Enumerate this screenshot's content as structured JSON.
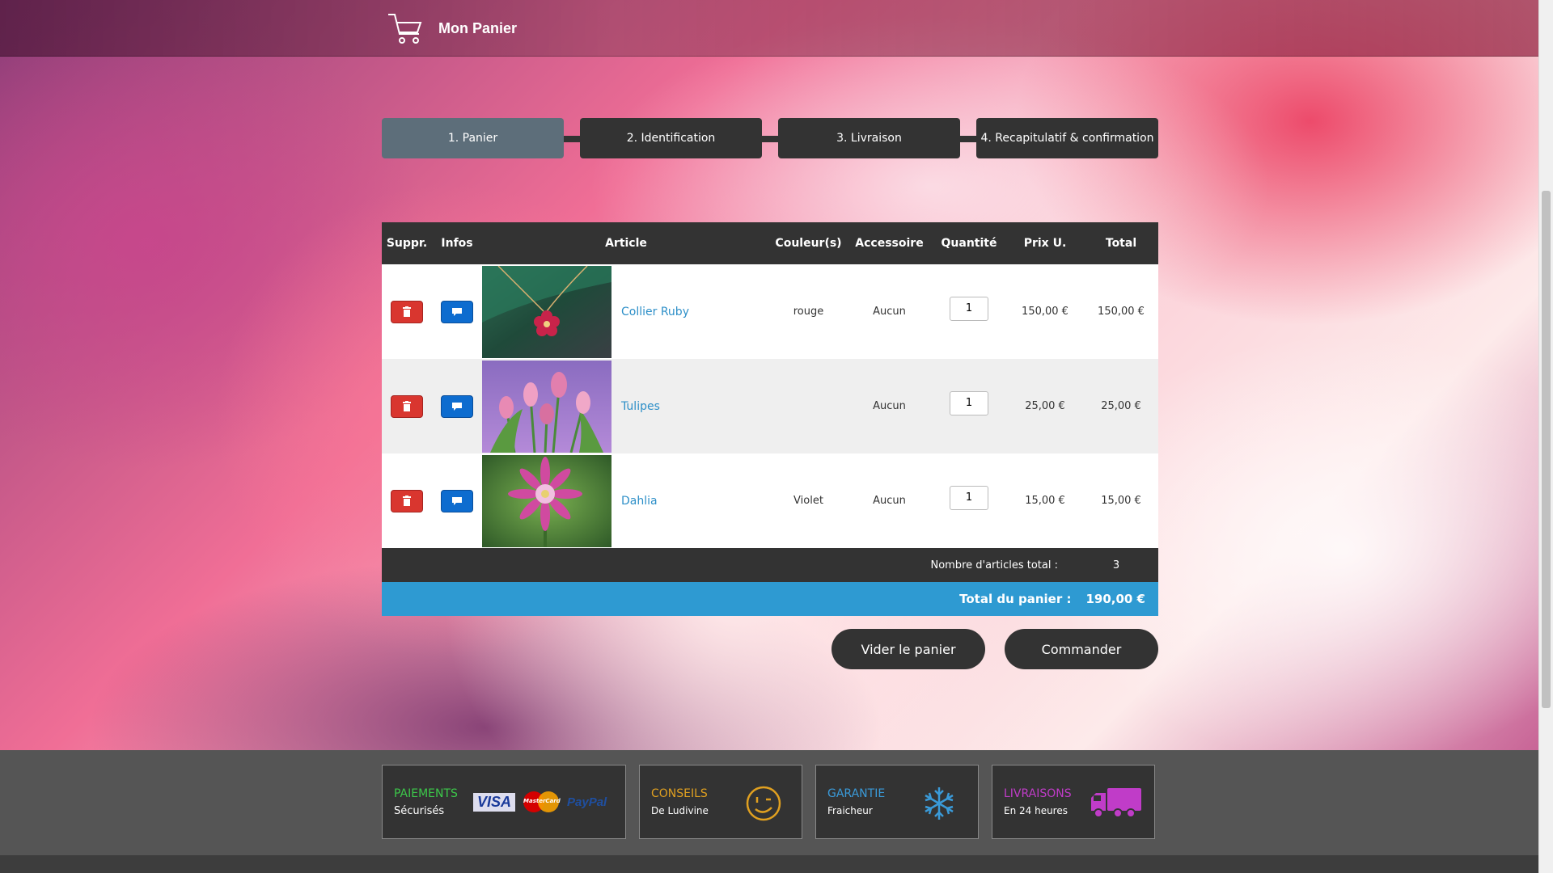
{
  "header": {
    "title": "Mon Panier"
  },
  "steps": [
    {
      "label": "1. Panier",
      "active": true
    },
    {
      "label": "2. Identification",
      "active": false
    },
    {
      "label": "3. Livraison",
      "active": false
    },
    {
      "label": "4. Recapitulatif & confirmation",
      "active": false
    }
  ],
  "cart": {
    "columns": [
      "Suppr.",
      "Infos",
      "Article",
      "Couleur(s)",
      "Accessoire",
      "Quantité",
      "Prix U.",
      "Total"
    ],
    "rows": [
      {
        "name": "Collier Ruby",
        "color": "rouge",
        "accessory": "Aucun",
        "qty": "1",
        "unit_price": "150,00 €",
        "total": "150,00 €",
        "image": "ruby-necklace"
      },
      {
        "name": "Tulipes",
        "color": "",
        "accessory": "Aucun",
        "qty": "1",
        "unit_price": "25,00 €",
        "total": "25,00 €",
        "image": "pink-tulips"
      },
      {
        "name": "Dahlia",
        "color": "Violet",
        "accessory": "Aucun",
        "qty": "1",
        "unit_price": "15,00 €",
        "total": "15,00 €",
        "image": "pink-dahlia"
      }
    ],
    "count_label": "Nombre d'articles total :",
    "count_value": "3",
    "total_label": "Total du panier :",
    "total_value": "190,00 €"
  },
  "actions": {
    "clear_label": "Vider le panier",
    "order_label": "Commander"
  },
  "footer": {
    "payments": {
      "title": "PAIEMENTS",
      "subtitle": "Sécurisés",
      "color": "#3cc84a",
      "logos": [
        "VISA",
        "MasterCard",
        "PayPal"
      ]
    },
    "advice": {
      "title": "CONSEILS",
      "subtitle": "De Ludivine",
      "color": "#e0a020",
      "icon": "wink-smiley-icon"
    },
    "guarantee": {
      "title": "GARANTIE",
      "subtitle": "Fraicheur",
      "color": "#3a9ad8",
      "icon": "snowflake-icon"
    },
    "delivery": {
      "title": "LIVRAISONS",
      "subtitle": "En 24 heures",
      "color": "#c03cc8",
      "icon": "truck-icon"
    }
  },
  "colors": {
    "delete": "#d9362f",
    "info": "#0d6ccf",
    "accent": "#2e9ad2",
    "dark": "#333333",
    "active_step": "#5d6e7a"
  }
}
